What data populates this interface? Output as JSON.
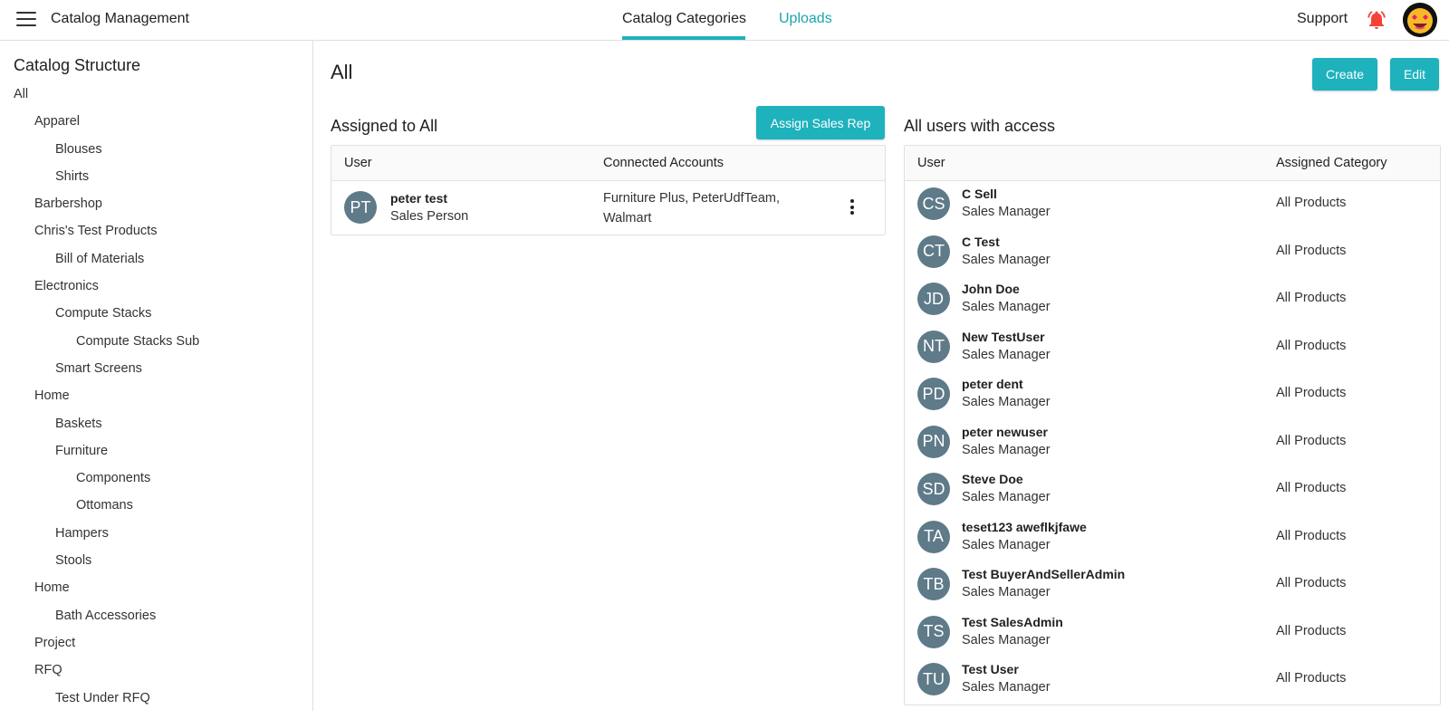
{
  "topbar": {
    "app_title": "Catalog Management",
    "tabs": [
      {
        "label": "Catalog Categories",
        "active": true
      },
      {
        "label": "Uploads",
        "active": false
      }
    ],
    "support_label": "Support",
    "accent_color": "#1eb2bd",
    "bell_color": "#f44336"
  },
  "sidebar": {
    "title": "Catalog Structure",
    "items": [
      {
        "label": "All",
        "level": 0
      },
      {
        "label": "Apparel",
        "level": 1
      },
      {
        "label": "Blouses",
        "level": 2
      },
      {
        "label": "Shirts",
        "level": 2
      },
      {
        "label": "Barbershop",
        "level": 1
      },
      {
        "label": "Chris's Test Products",
        "level": 1
      },
      {
        "label": "Bill of Materials",
        "level": 2
      },
      {
        "label": "Electronics",
        "level": 1
      },
      {
        "label": "Compute Stacks",
        "level": 2
      },
      {
        "label": "Compute Stacks Sub",
        "level": 3
      },
      {
        "label": "Smart Screens",
        "level": 2
      },
      {
        "label": "Home",
        "level": 1
      },
      {
        "label": "Baskets",
        "level": 2
      },
      {
        "label": "Furniture",
        "level": 2
      },
      {
        "label": "Components",
        "level": 3
      },
      {
        "label": "Ottomans",
        "level": 3
      },
      {
        "label": "Hampers",
        "level": 2
      },
      {
        "label": "Stools",
        "level": 2
      },
      {
        "label": "Home",
        "level": 1
      },
      {
        "label": "Bath Accessories",
        "level": 2
      },
      {
        "label": "Project",
        "level": 1
      },
      {
        "label": "RFQ",
        "level": 1
      },
      {
        "label": "Test Under RFQ",
        "level": 2
      }
    ]
  },
  "main": {
    "title": "All",
    "create_label": "Create",
    "edit_label": "Edit",
    "assigned": {
      "title": "Assigned to All",
      "assign_label": "Assign Sales Rep",
      "col_user": "User",
      "col_accounts": "Connected Accounts",
      "rows": [
        {
          "initials": "PT",
          "name": "peter test",
          "role": "Sales Person",
          "accounts_line1": "Furniture Plus, PeterUdfTeam,",
          "accounts_line2": "Walmart"
        }
      ]
    },
    "access": {
      "title": "All users with access",
      "col_user": "User",
      "col_category": "Assigned Category",
      "rows": [
        {
          "initials": "CS",
          "name": "C Sell",
          "role": "Sales Manager",
          "category": "All Products"
        },
        {
          "initials": "CT",
          "name": "C Test",
          "role": "Sales Manager",
          "category": "All Products"
        },
        {
          "initials": "JD",
          "name": "John Doe",
          "role": "Sales Manager",
          "category": "All Products"
        },
        {
          "initials": "NT",
          "name": "New TestUser",
          "role": "Sales Manager",
          "category": "All Products"
        },
        {
          "initials": "PD",
          "name": "peter dent",
          "role": "Sales Manager",
          "category": "All Products"
        },
        {
          "initials": "PN",
          "name": "peter newuser",
          "role": "Sales Manager",
          "category": "All Products"
        },
        {
          "initials": "SD",
          "name": "Steve Doe",
          "role": "Sales Manager",
          "category": "All Products"
        },
        {
          "initials": "TA",
          "name": "teset123 aweflkjfawe",
          "role": "Sales Manager",
          "category": "All Products"
        },
        {
          "initials": "TB",
          "name": "Test BuyerAndSellerAdmin",
          "role": "Sales Manager",
          "category": "All Products"
        },
        {
          "initials": "TS",
          "name": "Test SalesAdmin",
          "role": "Sales Manager",
          "category": "All Products"
        },
        {
          "initials": "TU",
          "name": "Test User",
          "role": "Sales Manager",
          "category": "All Products"
        }
      ]
    }
  }
}
